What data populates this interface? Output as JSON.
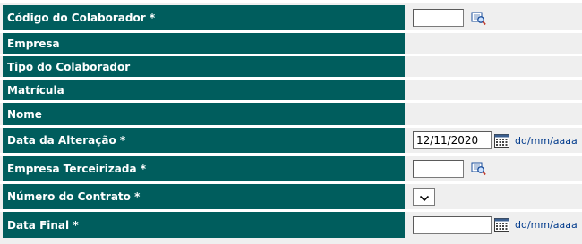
{
  "form": {
    "rows": [
      {
        "label": "Código do Colaborador *",
        "kind": "lookup",
        "value": "",
        "icon": "lookup-icon"
      },
      {
        "label": "Empresa",
        "kind": "readonly",
        "value": ""
      },
      {
        "label": "Tipo do Colaborador",
        "kind": "readonly",
        "value": ""
      },
      {
        "label": "Matrícula",
        "kind": "readonly",
        "value": ""
      },
      {
        "label": "Nome",
        "kind": "readonly",
        "value": ""
      },
      {
        "label": "Data da Alteração *",
        "kind": "date",
        "value": "12/11/2020",
        "icon": "calendar-icon",
        "format_hint": "dd/mm/aaaa"
      },
      {
        "label": "Empresa Terceirizada *",
        "kind": "lookup",
        "value": "",
        "icon": "lookup-icon"
      },
      {
        "label": "Número do Contrato *",
        "kind": "select",
        "selected": "",
        "icon": "chevron-down-icon"
      },
      {
        "label": "Data Final *",
        "kind": "date",
        "value": "",
        "icon": "calendar-icon",
        "format_hint": "dd/mm/aaaa"
      }
    ]
  },
  "colors": {
    "label_background": "#005d5d",
    "label_text": "#ffffff",
    "value_background": "#efefef",
    "separator": "#ffffff",
    "format_hint": "#003a8c"
  }
}
